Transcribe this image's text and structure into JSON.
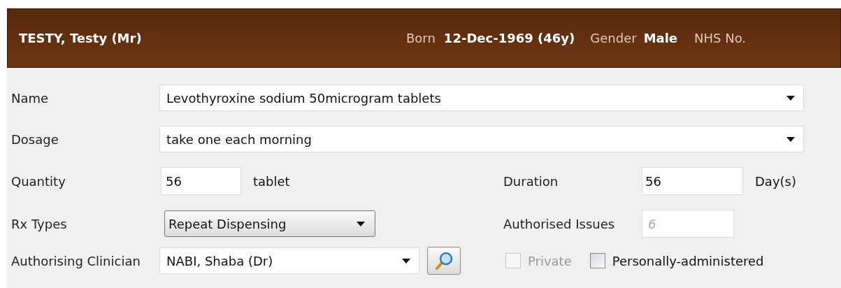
{
  "patient_banner": {
    "name": "TESTY,  Testy (Mr)",
    "born_label": "Born",
    "born_value": "12-Dec-1969 (46y)",
    "gender_label": "Gender",
    "gender_value": "Male",
    "nhs_label": "NHS No."
  },
  "form": {
    "name": {
      "label": "Name",
      "value": "Levothyroxine sodium 50microgram tablets"
    },
    "dosage": {
      "label": "Dosage",
      "value": "take one each morning"
    },
    "quantity": {
      "label": "Quantity",
      "value": "56",
      "unit": "tablet"
    },
    "duration": {
      "label": "Duration",
      "value": "56",
      "unit": "Day(s)"
    },
    "rx_types": {
      "label": "Rx Types",
      "value": "Repeat Dispensing"
    },
    "authorised_issues": {
      "label": "Authorised Issues",
      "value": "6",
      "disabled": true
    },
    "clinician": {
      "label": "Authorising Clinician",
      "value": "NABI, Shaba (Dr)"
    },
    "checkboxes": [
      {
        "label": "Private",
        "checked": false,
        "disabled": true
      },
      {
        "label": "Personally-administered",
        "checked": false,
        "disabled": false
      }
    ]
  }
}
